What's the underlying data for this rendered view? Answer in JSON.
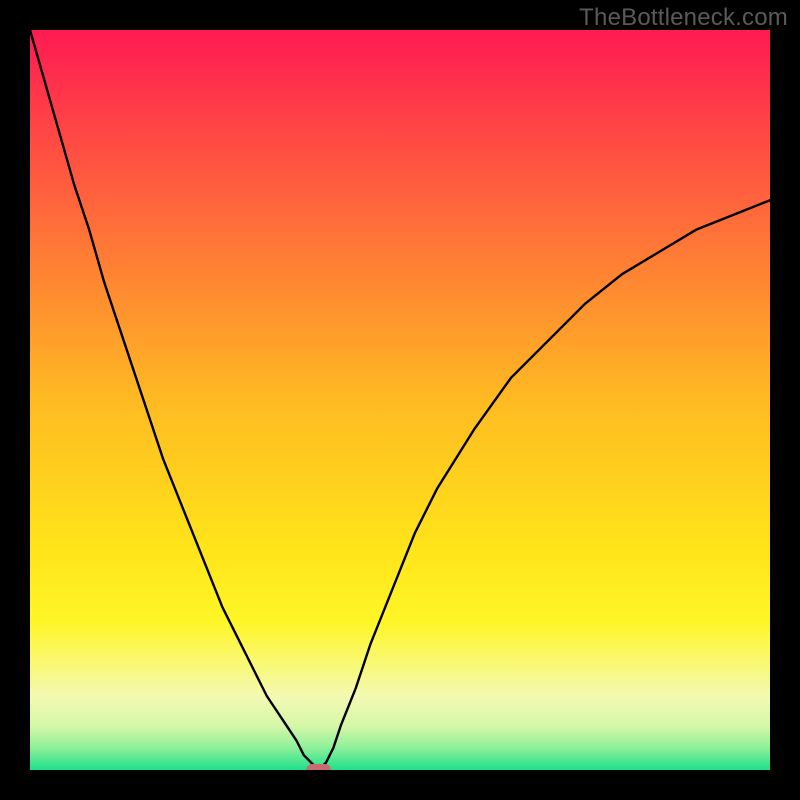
{
  "watermark": "TheBottleneck.com",
  "chart_data": {
    "type": "line",
    "title": "",
    "xlabel": "",
    "ylabel": "",
    "xlim": [
      0,
      100
    ],
    "ylim": [
      0,
      100
    ],
    "grid": false,
    "series": [
      {
        "name": "curve",
        "x": [
          0,
          2,
          4,
          6,
          8,
          10,
          12,
          14,
          16,
          18,
          20,
          22,
          24,
          26,
          28,
          30,
          32,
          34,
          36,
          37,
          38,
          39,
          40,
          41,
          42,
          44,
          46,
          48,
          50,
          52,
          55,
          60,
          65,
          70,
          75,
          80,
          85,
          90,
          95,
          100
        ],
        "values": [
          100,
          93,
          86,
          79,
          73,
          66,
          60,
          54,
          48,
          42,
          37,
          32,
          27,
          22,
          18,
          14,
          10,
          7,
          4,
          2,
          1,
          0,
          1,
          3,
          6,
          11,
          17,
          22,
          27,
          32,
          38,
          46,
          53,
          58,
          63,
          67,
          70,
          73,
          75,
          77
        ]
      }
    ],
    "marker": {
      "x": 39,
      "y": 0,
      "color": "#c96b6f"
    },
    "background_gradient": {
      "stops": [
        {
          "offset": 0.0,
          "color": "#ff1a52"
        },
        {
          "offset": 0.25,
          "color": "#ff6a3a"
        },
        {
          "offset": 0.5,
          "color": "#ffba22"
        },
        {
          "offset": 0.7,
          "color": "#ffe41a"
        },
        {
          "offset": 0.8,
          "color": "#fff627"
        },
        {
          "offset": 0.9,
          "color": "#f4f9b2"
        },
        {
          "offset": 0.94,
          "color": "#d6f7a8"
        },
        {
          "offset": 0.97,
          "color": "#8ef09a"
        },
        {
          "offset": 1.0,
          "color": "#1fe08a"
        }
      ]
    }
  }
}
